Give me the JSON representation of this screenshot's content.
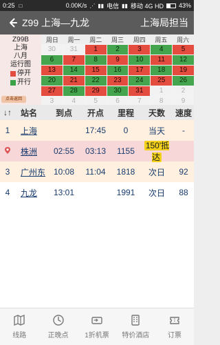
{
  "statusbar": {
    "time": "0:25",
    "speed": "0.00K/s",
    "carrier1": "电信",
    "carrier2": "移动 4G HD",
    "battery": "43%"
  },
  "appbar": {
    "title": "Z99 上海—九龙",
    "right_label": "上海局担当"
  },
  "calendar": {
    "train": "Z99B",
    "origin": "上海",
    "month": "八月",
    "chart_label": "运行图",
    "legend": [
      {
        "label": "停开",
        "color": "#e34c3f"
      },
      {
        "label": "开行",
        "color": "#3da145"
      }
    ],
    "button_label": "点击返回",
    "weekdays": [
      "周日",
      "周一",
      "周二",
      "周三",
      "周四",
      "周五",
      "周六"
    ],
    "days": [
      {
        "d": "30",
        "s": "empty"
      },
      {
        "d": "31",
        "s": "empty"
      },
      {
        "d": "1",
        "s": "red"
      },
      {
        "d": "2",
        "s": "green"
      },
      {
        "d": "3",
        "s": "red"
      },
      {
        "d": "4",
        "s": "green"
      },
      {
        "d": "5",
        "s": "red"
      },
      {
        "d": "6",
        "s": "green"
      },
      {
        "d": "7",
        "s": "red"
      },
      {
        "d": "8",
        "s": "green"
      },
      {
        "d": "9",
        "s": "red"
      },
      {
        "d": "10",
        "s": "green"
      },
      {
        "d": "11",
        "s": "red"
      },
      {
        "d": "12",
        "s": "green"
      },
      {
        "d": "13",
        "s": "red"
      },
      {
        "d": "14",
        "s": "green"
      },
      {
        "d": "15",
        "s": "red"
      },
      {
        "d": "16",
        "s": "green"
      },
      {
        "d": "17",
        "s": "red"
      },
      {
        "d": "18",
        "s": "green"
      },
      {
        "d": "19",
        "s": "red"
      },
      {
        "d": "20",
        "s": "green"
      },
      {
        "d": "21",
        "s": "red"
      },
      {
        "d": "22",
        "s": "green"
      },
      {
        "d": "23",
        "s": "red"
      },
      {
        "d": "24",
        "s": "green"
      },
      {
        "d": "25",
        "s": "red"
      },
      {
        "d": "26",
        "s": "green"
      },
      {
        "d": "27",
        "s": "red"
      },
      {
        "d": "28",
        "s": "green"
      },
      {
        "d": "29",
        "s": "red"
      },
      {
        "d": "30",
        "s": "green"
      },
      {
        "d": "31",
        "s": "red"
      },
      {
        "d": "1",
        "s": "empty"
      },
      {
        "d": "2",
        "s": "empty"
      },
      {
        "d": "3",
        "s": "empty"
      },
      {
        "d": "4",
        "s": "empty"
      },
      {
        "d": "5",
        "s": "empty"
      },
      {
        "d": "6",
        "s": "empty"
      },
      {
        "d": "7",
        "s": "empty"
      },
      {
        "d": "8",
        "s": "empty"
      },
      {
        "d": "9",
        "s": "empty"
      }
    ]
  },
  "table": {
    "headers": {
      "sort": "↓↑",
      "station": "站名",
      "arrive": "到点",
      "depart": "开点",
      "mileage": "里程",
      "days": "天数",
      "speed": "速度"
    },
    "rows": [
      {
        "no": "1",
        "station": "上海",
        "arrive": "",
        "depart": "17:45",
        "mileage": "0",
        "days": "当天",
        "speed": "-",
        "style": "alt",
        "icon": ""
      },
      {
        "no": "",
        "station": "株洲",
        "arrive": "02:55",
        "depart": "03:13",
        "mileage": "1155",
        "days": "150'抵达",
        "speed": "",
        "style": "hl",
        "icon": "location-pin-icon"
      },
      {
        "no": "3",
        "station": "广州东",
        "arrive": "10:08",
        "depart": "11:04",
        "mileage": "1818",
        "days": "次日",
        "speed": "92",
        "style": "alt",
        "icon": ""
      },
      {
        "no": "4",
        "station": "九龙",
        "arrive": "13:01",
        "depart": "",
        "mileage": "1991",
        "days": "次日",
        "speed": "88",
        "style": "",
        "icon": ""
      }
    ]
  },
  "bottomnav": {
    "items": [
      {
        "label": "线路",
        "icon": "route-map-icon"
      },
      {
        "label": "正晚点",
        "icon": "clock-icon"
      },
      {
        "label": "1折机票",
        "icon": "plane-ticket-icon"
      },
      {
        "label": "特价酒店",
        "icon": "hotel-icon"
      },
      {
        "label": "订票",
        "icon": "ticket-icon"
      }
    ]
  }
}
